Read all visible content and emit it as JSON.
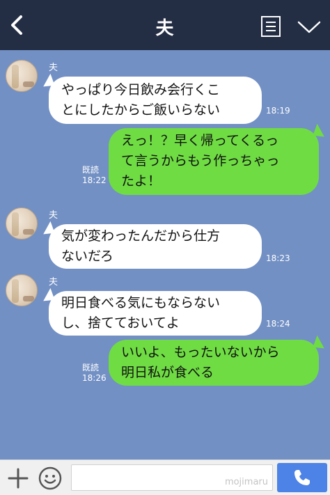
{
  "header": {
    "title": "夫",
    "icons": [
      "back-icon",
      "notes-icon",
      "chevron-down-icon"
    ]
  },
  "messages": [
    {
      "side": "in",
      "sender": "夫",
      "text": "やっぱり今日飲み会行くこ\nとにしたからご飯いらない",
      "time": "18:19"
    },
    {
      "side": "out",
      "read": "既読",
      "text": "えっ！？早く帰ってくるっ\nて言うからもう作っちゃっ\nたよ！",
      "time": "18:22"
    },
    {
      "side": "in",
      "sender": "夫",
      "text": "気が変わったんだから仕方\nないだろ",
      "time": "18:23"
    },
    {
      "side": "in",
      "sender": "夫",
      "text": "明日食べる気にもならない\nし、捨てておいてよ",
      "time": "18:24"
    },
    {
      "side": "out",
      "read": "既読",
      "text": "いいよ、もったいないから\n明日私が食べる",
      "time": "18:26"
    }
  ],
  "composer": {
    "watermark": "mojimaru",
    "icons": [
      "plus-icon",
      "smile-icon",
      "phone-icon"
    ]
  },
  "colors": {
    "header_bg": "#232d44",
    "chat_bg": "#7290c4",
    "incoming_bubble": "#ffffff",
    "outgoing_bubble": "#6fdc44",
    "call_button": "#4d82e6"
  }
}
